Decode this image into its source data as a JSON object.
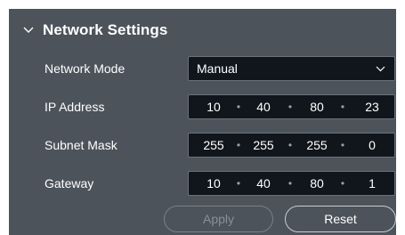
{
  "section": {
    "title": "Network Settings",
    "collapse_icon": "chevron-down-icon"
  },
  "network_mode": {
    "label": "Network Mode",
    "value": "Manual",
    "dropdown_icon": "chevron-down-icon"
  },
  "ip_address": {
    "label": "IP Address",
    "octets": [
      "10",
      "40",
      "80",
      "23"
    ],
    "separator": "•"
  },
  "subnet_mask": {
    "label": "Subnet Mask",
    "octets": [
      "255",
      "255",
      "255",
      "0"
    ],
    "separator": "•"
  },
  "gateway": {
    "label": "Gateway",
    "octets": [
      "10",
      "40",
      "80",
      "1"
    ],
    "separator": "•"
  },
  "buttons": {
    "apply": "Apply",
    "reset": "Reset"
  },
  "colors": {
    "panel_bg": "#4c535b",
    "field_bg": "#11161c",
    "text": "#ffffff",
    "disabled_text": "#8a9096"
  }
}
